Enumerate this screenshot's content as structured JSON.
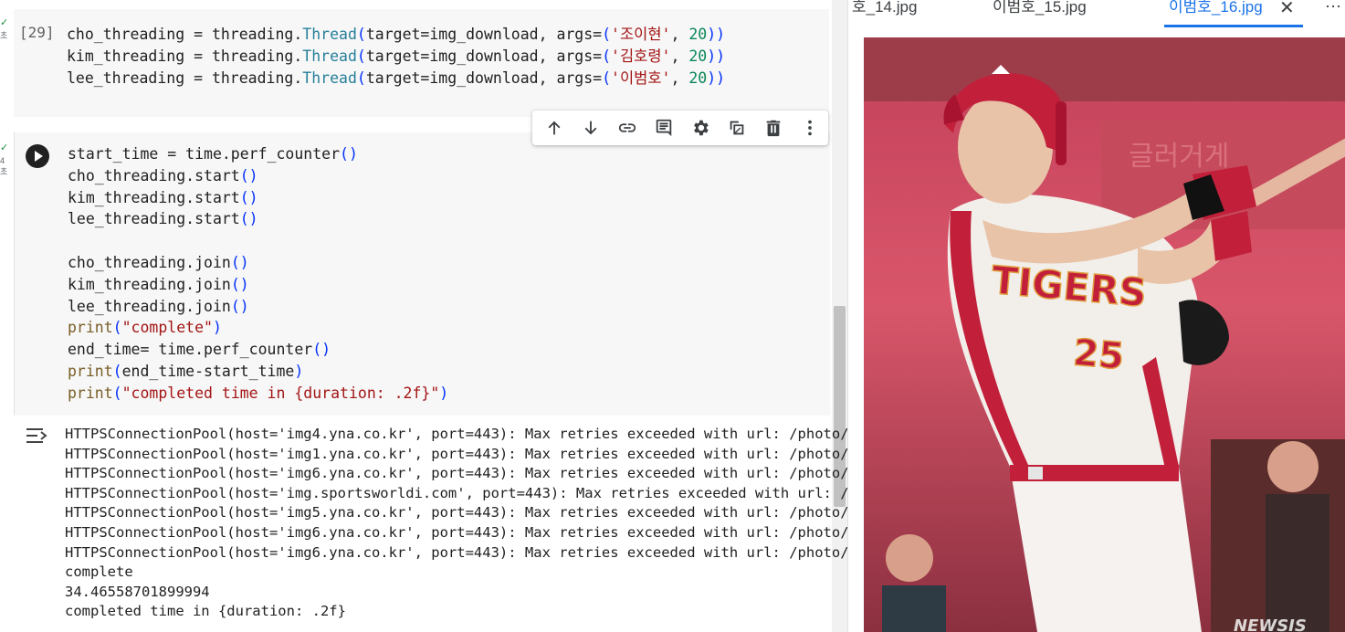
{
  "cells": [
    {
      "execution_count": "[29]",
      "lines": [
        [
          "cho_threading = threading.",
          "Thread",
          "(",
          "target=img_download, args=",
          "(",
          "'조이현'",
          ", ",
          "20",
          ")",
          ")"
        ],
        [
          "kim_threading = threading.",
          "Thread",
          "(",
          "target=img_download, args=",
          "(",
          "'김호령'",
          ", ",
          "20",
          ")",
          ")"
        ],
        [
          "lee_threading = threading.",
          "Thread",
          "(",
          "target=img_download, args=",
          "(",
          "'이범호'",
          ", ",
          "20",
          ")",
          ")"
        ]
      ]
    },
    {
      "lines": [
        "start_time = time.perf_counter()",
        "cho_threading.start()",
        "kim_threading.start()",
        "lee_threading.start()",
        "",
        "cho_threading.join()",
        "kim_threading.join()",
        "lee_threading.join()",
        "print(\"complete\")",
        "end_time= time.perf_counter()",
        "print(end_time-start_time)",
        "print(\"completed time in {duration: .2f}\")"
      ]
    }
  ],
  "gutter": {
    "cell1_mark": "✓",
    "cell1_sub": "초",
    "cell2_mark": "✓",
    "cell2_num": "4",
    "cell2_sub": "초"
  },
  "toolbar": [
    "arrow-up-icon",
    "arrow-down-icon",
    "link-icon",
    "comment-icon",
    "gear-icon",
    "mirror-icon",
    "trash-icon",
    "more-vert-icon"
  ],
  "output": {
    "lines": [
      "HTTPSConnectionPool(host='img4.yna.co.kr', port=443): Max retries exceeded with url: /photo/c",
      "HTTPSConnectionPool(host='img1.yna.co.kr', port=443): Max retries exceeded with url: /photo/y",
      "HTTPSConnectionPool(host='img6.yna.co.kr', port=443): Max retries exceeded with url: /photo/y",
      "HTTPSConnectionPool(host='img.sportsworldi.com', port=443): Max retries exceeded with url: /c",
      "HTTPSConnectionPool(host='img5.yna.co.kr', port=443): Max retries exceeded with url: /photo/y",
      "HTTPSConnectionPool(host='img6.yna.co.kr', port=443): Max retries exceeded with url: /photo/y",
      "HTTPSConnectionPool(host='img6.yna.co.kr', port=443): Max retries exceeded with url: /photo/y",
      "complete",
      "34.46558701899994",
      "completed time in {duration: .2f}"
    ]
  },
  "viewer": {
    "tabs": [
      "호_14.jpg",
      "이범호_15.jpg",
      "이범호_16.jpg"
    ],
    "active_tab": "이범호_16.jpg",
    "close": "✕",
    "more": "⋯",
    "photo": {
      "jersey_text": "TIGERS",
      "jersey_number": "25",
      "watermark": "NEWSIS"
    }
  },
  "colors": {
    "accent": "#1a73e8",
    "string": "#a31515",
    "number": "#098658",
    "class": "#267f99"
  }
}
